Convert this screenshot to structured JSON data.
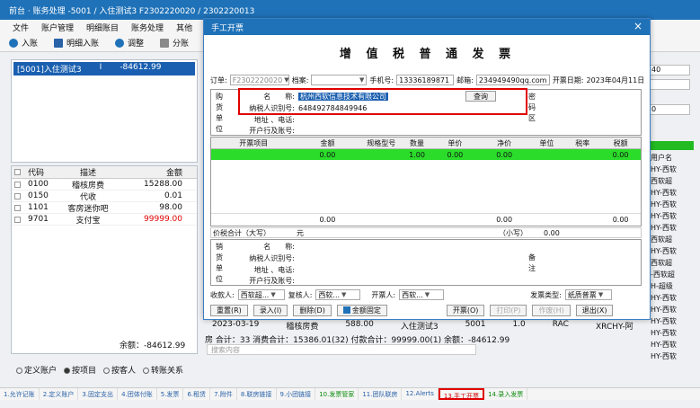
{
  "window": {
    "title": "前台 · 账务处理 -5001 / 入住测试3  F2302220020 / 2302220013"
  },
  "menu": [
    "文件",
    "账户管理",
    "明细账目",
    "账务处理",
    "其他"
  ],
  "toolbar": {
    "enter": "入账",
    "detail_enter": "明细入账",
    "adjust": "调整",
    "split": "分账"
  },
  "account_list": {
    "room": "[5001]入住测试3",
    "flag": "I",
    "amount": "-84612.99"
  },
  "code_table": {
    "headers": [
      "代码",
      "描述",
      "金额"
    ],
    "rows": [
      {
        "code": "0100",
        "desc": "稽核房费",
        "amount": "15288.00"
      },
      {
        "code": "0150",
        "desc": "代收",
        "amount": "0.01"
      },
      {
        "code": "1101",
        "desc": "客房迷你吧",
        "amount": "98.00"
      },
      {
        "code": "9701",
        "desc": "支付宝",
        "amount": "99999.00"
      }
    ],
    "total": "余额：-84612.99"
  },
  "radios": [
    "定义账户",
    "按项目",
    "按客人",
    "转账关系"
  ],
  "bottom_tabs": [
    "1.允许记账",
    "2.定义账户",
    "3.固定支出",
    "4.团体付账",
    "5.发票",
    "6.租赁",
    "7.附件",
    "8.联房链接",
    "9.小团链接",
    "10.发票管家",
    "11.团队联房",
    "12.Alerts",
    "13.手工开票",
    "14.录入发票"
  ],
  "background": {
    "row_date": "2023-03-19",
    "row_desc": "稽核房费",
    "row_amount": "588.00",
    "row_guest": "入住测试3",
    "row_room": "5001",
    "row_qty": "1.0",
    "row_code": "RAC",
    "row_user": "XRCHY-阿",
    "status": "房 合计：33  消费合计：15386.01(32)  付款合计：99999.00(1)  余额：-84612.99",
    "search": "搜索内容"
  },
  "right_col": {
    "box1": "40",
    "box2": "",
    "box3": "0",
    "list": [
      "用户名",
      "HY-西软",
      "西软超",
      "HY-西软",
      "HY-西软",
      "HY-西软",
      "HY-西软",
      "西软超",
      "HY-西软",
      "西软超",
      "-西软超",
      "H-超级",
      "HY-西软",
      "HY-西软",
      "HY-西软",
      "HY-西软",
      "HY-西软",
      "HY-西软"
    ]
  },
  "dialog": {
    "title": "手工开票",
    "invoice_title": "增 值 税 普 通 发 票",
    "order_label": "订单:",
    "order_value": "F2302220020",
    "archive_label": "档案:",
    "phone_label": "手机号:",
    "phone_value": "13336189871",
    "email_label": "邮箱:",
    "email_value": "234949490qq.com",
    "date_label": "开票日期:",
    "date_value": "2023年04月11日",
    "buyer_side": [
      "购",
      "货",
      "单",
      "位"
    ],
    "buyer": {
      "name_label": "名　　称:",
      "name_value": "杭州西软信息技术有限公司",
      "query": "查询",
      "tax_label": "纳税人识别号:",
      "tax_value": "648492784849946",
      "addr_label": "地址 、电话:",
      "bank_label": "开户行及账号:"
    },
    "pw_side": [
      "密",
      "码",
      "区"
    ],
    "items_headers": [
      "开票项目",
      "金额",
      "规格型号",
      "数量",
      "单价",
      "净价",
      "单位",
      "税率",
      "税额"
    ],
    "items_row": {
      "amount": "0.00",
      "qty": "1.00",
      "price": "0.00",
      "net": "0.00",
      "tax": "0.00"
    },
    "items_total": {
      "amount": "0.00",
      "net": "0.00",
      "tax": "0.00"
    },
    "tax_total_label": "价税合计（大写）",
    "tax_total_value": "元",
    "small_label": "（小写）",
    "small_value": "0.00",
    "seller_side": [
      "销",
      "货",
      "单",
      "位"
    ],
    "seller": {
      "name_label": "名　　称:",
      "tax_label": "纳税人识别号:",
      "addr_label": "地址 、电话:",
      "bank_label": "开户行及账号:"
    },
    "note_side": [
      "备",
      "注"
    ],
    "payee_label": "收款人:",
    "payee_value": "西软超...",
    "reviewer_label": "复核人:",
    "reviewer_value": "西软...",
    "issuer_label": "开票人:",
    "issuer_value": "西软...",
    "invoice_type_label": "发票类型:",
    "invoice_type_value": "纸质普票",
    "buttons": {
      "reset": "重置(R)",
      "enter": "录入(I)",
      "delete": "删除(D)",
      "fixed": "金额固定",
      "issue": "开票(O)",
      "print": "打印(P)",
      "void": "作废(H)",
      "exit": "退出(X)"
    }
  },
  "colors": {
    "titlebar": "#1f72b8",
    "highlight": "#1a5fb0",
    "green": "#2bdc2b",
    "red_box": "#e00000"
  }
}
